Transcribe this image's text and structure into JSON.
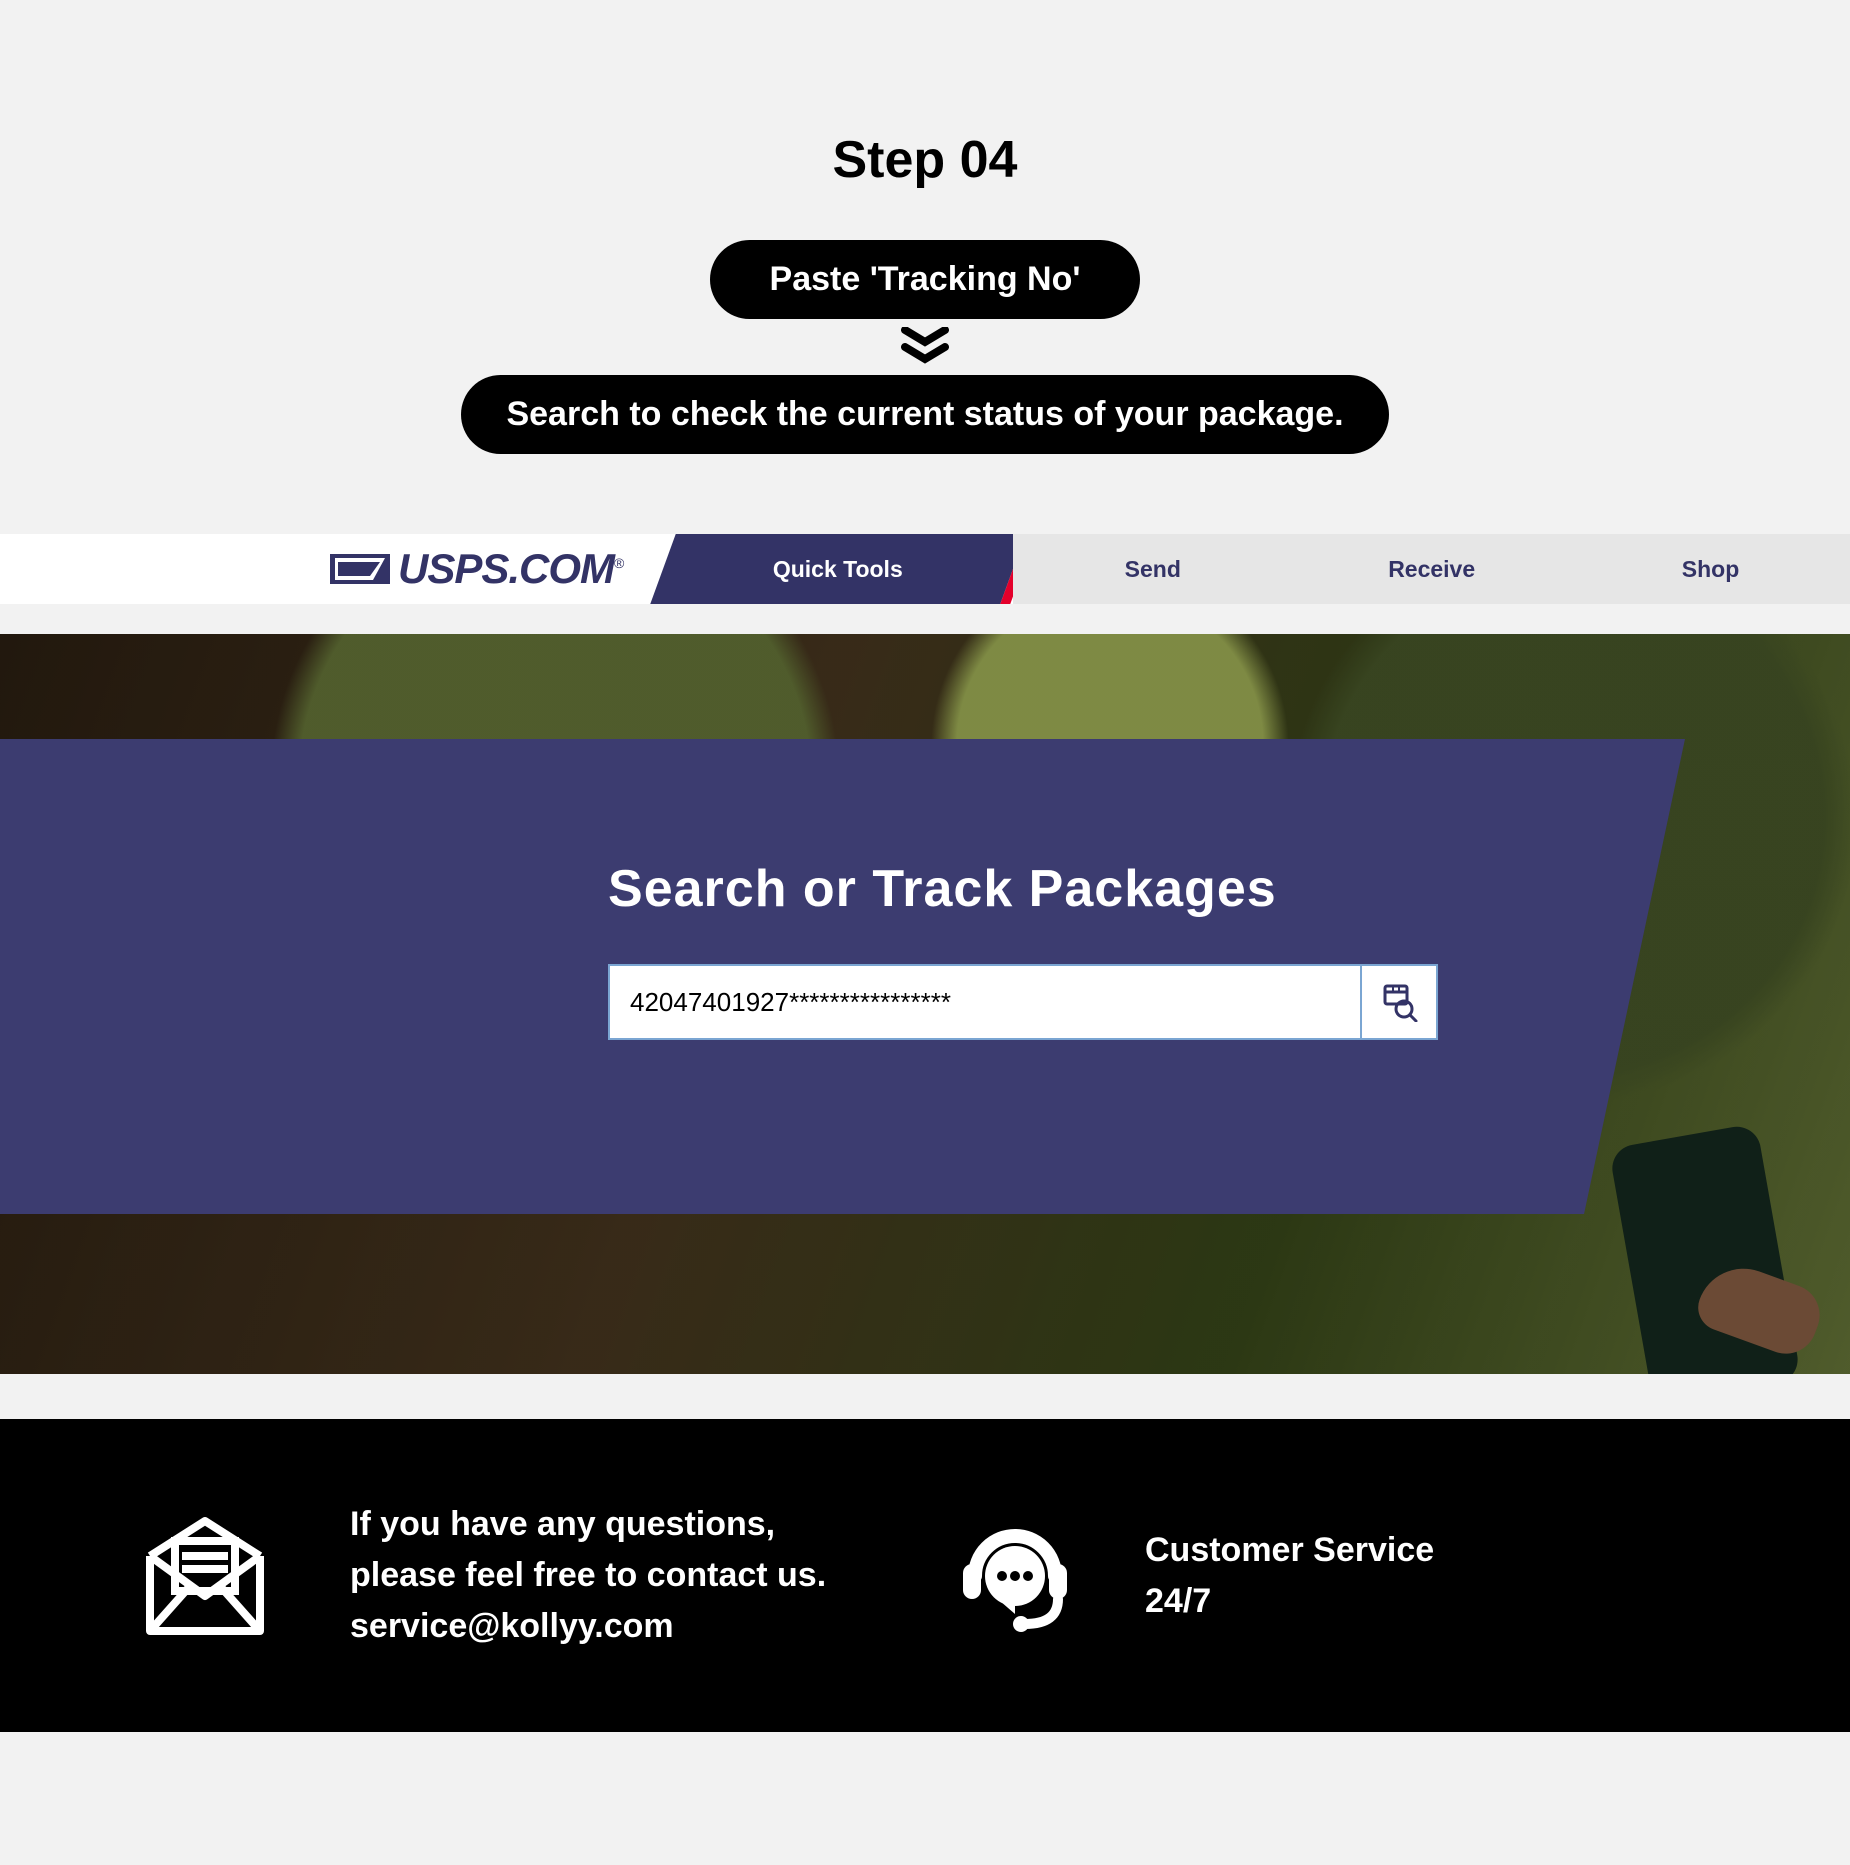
{
  "step": {
    "title": "Step 04",
    "pill_a": "Paste 'Tracking No'",
    "pill_b": "Search to check the current status of your package."
  },
  "nav": {
    "logo_text": "USPS.COM",
    "items": {
      "quick_tools": "Quick Tools",
      "send": "Send",
      "receive": "Receive",
      "shop": "Shop"
    }
  },
  "hero": {
    "title": "Search or Track Packages",
    "tracking_value": "42047401927****************"
  },
  "footer": {
    "left_line1": "If you have any questions,",
    "left_line2": "please feel free to contact us.",
    "email": "service@kollyy.com",
    "right_line1": "Customer Service",
    "right_line2": "24/7"
  }
}
